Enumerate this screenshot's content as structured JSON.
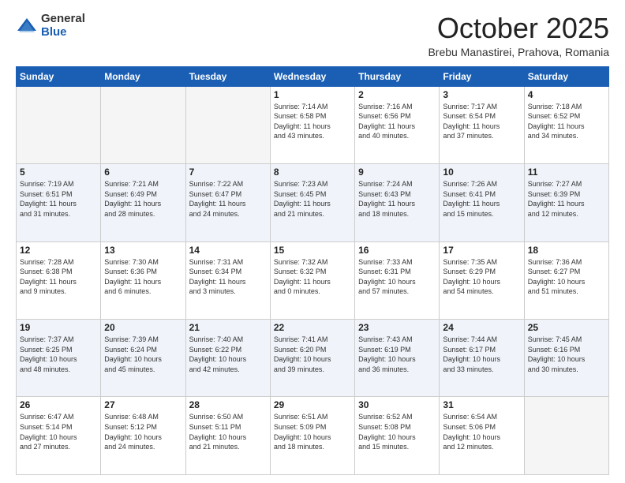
{
  "header": {
    "logo_general": "General",
    "logo_blue": "Blue",
    "month_title": "October 2025",
    "location": "Brebu Manastirei, Prahova, Romania"
  },
  "days_of_week": [
    "Sunday",
    "Monday",
    "Tuesday",
    "Wednesday",
    "Thursday",
    "Friday",
    "Saturday"
  ],
  "weeks": [
    [
      {
        "day": "",
        "info": ""
      },
      {
        "day": "",
        "info": ""
      },
      {
        "day": "",
        "info": ""
      },
      {
        "day": "1",
        "info": "Sunrise: 7:14 AM\nSunset: 6:58 PM\nDaylight: 11 hours\nand 43 minutes."
      },
      {
        "day": "2",
        "info": "Sunrise: 7:16 AM\nSunset: 6:56 PM\nDaylight: 11 hours\nand 40 minutes."
      },
      {
        "day": "3",
        "info": "Sunrise: 7:17 AM\nSunset: 6:54 PM\nDaylight: 11 hours\nand 37 minutes."
      },
      {
        "day": "4",
        "info": "Sunrise: 7:18 AM\nSunset: 6:52 PM\nDaylight: 11 hours\nand 34 minutes."
      }
    ],
    [
      {
        "day": "5",
        "info": "Sunrise: 7:19 AM\nSunset: 6:51 PM\nDaylight: 11 hours\nand 31 minutes."
      },
      {
        "day": "6",
        "info": "Sunrise: 7:21 AM\nSunset: 6:49 PM\nDaylight: 11 hours\nand 28 minutes."
      },
      {
        "day": "7",
        "info": "Sunrise: 7:22 AM\nSunset: 6:47 PM\nDaylight: 11 hours\nand 24 minutes."
      },
      {
        "day": "8",
        "info": "Sunrise: 7:23 AM\nSunset: 6:45 PM\nDaylight: 11 hours\nand 21 minutes."
      },
      {
        "day": "9",
        "info": "Sunrise: 7:24 AM\nSunset: 6:43 PM\nDaylight: 11 hours\nand 18 minutes."
      },
      {
        "day": "10",
        "info": "Sunrise: 7:26 AM\nSunset: 6:41 PM\nDaylight: 11 hours\nand 15 minutes."
      },
      {
        "day": "11",
        "info": "Sunrise: 7:27 AM\nSunset: 6:39 PM\nDaylight: 11 hours\nand 12 minutes."
      }
    ],
    [
      {
        "day": "12",
        "info": "Sunrise: 7:28 AM\nSunset: 6:38 PM\nDaylight: 11 hours\nand 9 minutes."
      },
      {
        "day": "13",
        "info": "Sunrise: 7:30 AM\nSunset: 6:36 PM\nDaylight: 11 hours\nand 6 minutes."
      },
      {
        "day": "14",
        "info": "Sunrise: 7:31 AM\nSunset: 6:34 PM\nDaylight: 11 hours\nand 3 minutes."
      },
      {
        "day": "15",
        "info": "Sunrise: 7:32 AM\nSunset: 6:32 PM\nDaylight: 11 hours\nand 0 minutes."
      },
      {
        "day": "16",
        "info": "Sunrise: 7:33 AM\nSunset: 6:31 PM\nDaylight: 10 hours\nand 57 minutes."
      },
      {
        "day": "17",
        "info": "Sunrise: 7:35 AM\nSunset: 6:29 PM\nDaylight: 10 hours\nand 54 minutes."
      },
      {
        "day": "18",
        "info": "Sunrise: 7:36 AM\nSunset: 6:27 PM\nDaylight: 10 hours\nand 51 minutes."
      }
    ],
    [
      {
        "day": "19",
        "info": "Sunrise: 7:37 AM\nSunset: 6:25 PM\nDaylight: 10 hours\nand 48 minutes."
      },
      {
        "day": "20",
        "info": "Sunrise: 7:39 AM\nSunset: 6:24 PM\nDaylight: 10 hours\nand 45 minutes."
      },
      {
        "day": "21",
        "info": "Sunrise: 7:40 AM\nSunset: 6:22 PM\nDaylight: 10 hours\nand 42 minutes."
      },
      {
        "day": "22",
        "info": "Sunrise: 7:41 AM\nSunset: 6:20 PM\nDaylight: 10 hours\nand 39 minutes."
      },
      {
        "day": "23",
        "info": "Sunrise: 7:43 AM\nSunset: 6:19 PM\nDaylight: 10 hours\nand 36 minutes."
      },
      {
        "day": "24",
        "info": "Sunrise: 7:44 AM\nSunset: 6:17 PM\nDaylight: 10 hours\nand 33 minutes."
      },
      {
        "day": "25",
        "info": "Sunrise: 7:45 AM\nSunset: 6:16 PM\nDaylight: 10 hours\nand 30 minutes."
      }
    ],
    [
      {
        "day": "26",
        "info": "Sunrise: 6:47 AM\nSunset: 5:14 PM\nDaylight: 10 hours\nand 27 minutes."
      },
      {
        "day": "27",
        "info": "Sunrise: 6:48 AM\nSunset: 5:12 PM\nDaylight: 10 hours\nand 24 minutes."
      },
      {
        "day": "28",
        "info": "Sunrise: 6:50 AM\nSunset: 5:11 PM\nDaylight: 10 hours\nand 21 minutes."
      },
      {
        "day": "29",
        "info": "Sunrise: 6:51 AM\nSunset: 5:09 PM\nDaylight: 10 hours\nand 18 minutes."
      },
      {
        "day": "30",
        "info": "Sunrise: 6:52 AM\nSunset: 5:08 PM\nDaylight: 10 hours\nand 15 minutes."
      },
      {
        "day": "31",
        "info": "Sunrise: 6:54 AM\nSunset: 5:06 PM\nDaylight: 10 hours\nand 12 minutes."
      },
      {
        "day": "",
        "info": ""
      }
    ]
  ]
}
